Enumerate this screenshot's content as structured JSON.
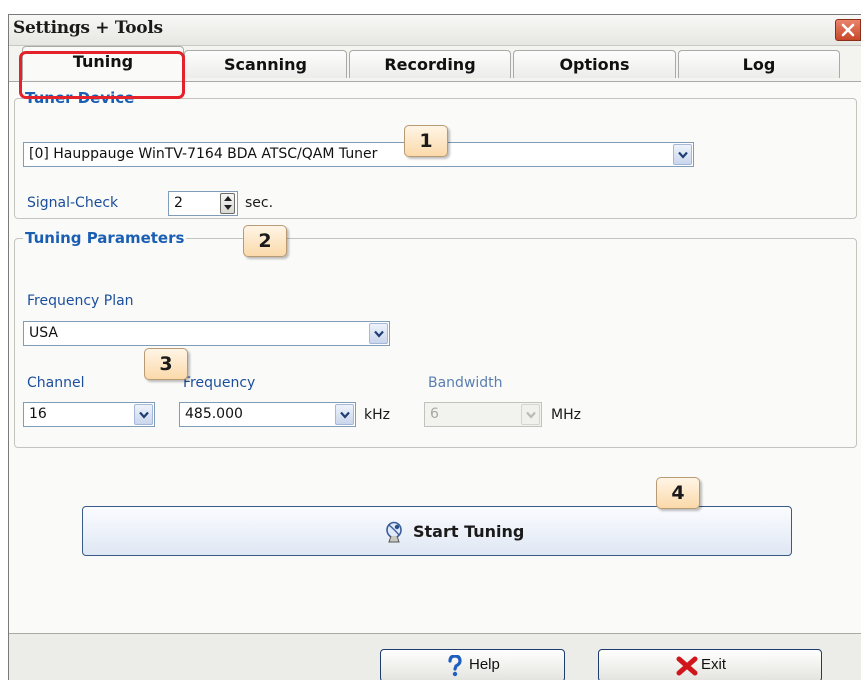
{
  "window": {
    "title": "Settings + Tools"
  },
  "tabs": [
    {
      "label": "Tuning",
      "active": true
    },
    {
      "label": "Scanning",
      "active": false
    },
    {
      "label": "Recording",
      "active": false
    },
    {
      "label": "Options",
      "active": false
    },
    {
      "label": "Log",
      "active": false
    }
  ],
  "tuner_device": {
    "legend": "Tuner Device",
    "device_value": "[0] Hauppauge WinTV-7164 BDA ATSC/QAM Tuner",
    "signal_check_label": "Signal-Check",
    "signal_check_value": "2",
    "signal_check_unit": "sec."
  },
  "tuning_parameters": {
    "legend": "Tuning Parameters",
    "frequency_plan_label": "Frequency Plan",
    "frequency_plan_value": "USA",
    "channel_label": "Channel",
    "channel_value": "16",
    "frequency_label": "Frequency",
    "frequency_value": "485.000",
    "frequency_unit": "kHz",
    "bandwidth_label": "Bandwidth",
    "bandwidth_value": "6",
    "bandwidth_unit": "MHz"
  },
  "actions": {
    "start_tuning_label": "Start Tuning"
  },
  "footer": {
    "help_label": "Help",
    "exit_label": "Exit"
  },
  "callouts": [
    "1",
    "2",
    "3",
    "4"
  ],
  "colors": {
    "legend": "#1b5fb3",
    "highlight": "#e3222b",
    "callout_fill": "#fbd9aa",
    "close_button": "#c8472a"
  },
  "icons": {
    "close": "close-icon",
    "start_tuning": "satellite-dish-icon",
    "help": "question-mark-icon",
    "exit": "red-x-icon",
    "dropdown": "chevron-down-icon",
    "spinner": "spinner-arrows-icon"
  }
}
